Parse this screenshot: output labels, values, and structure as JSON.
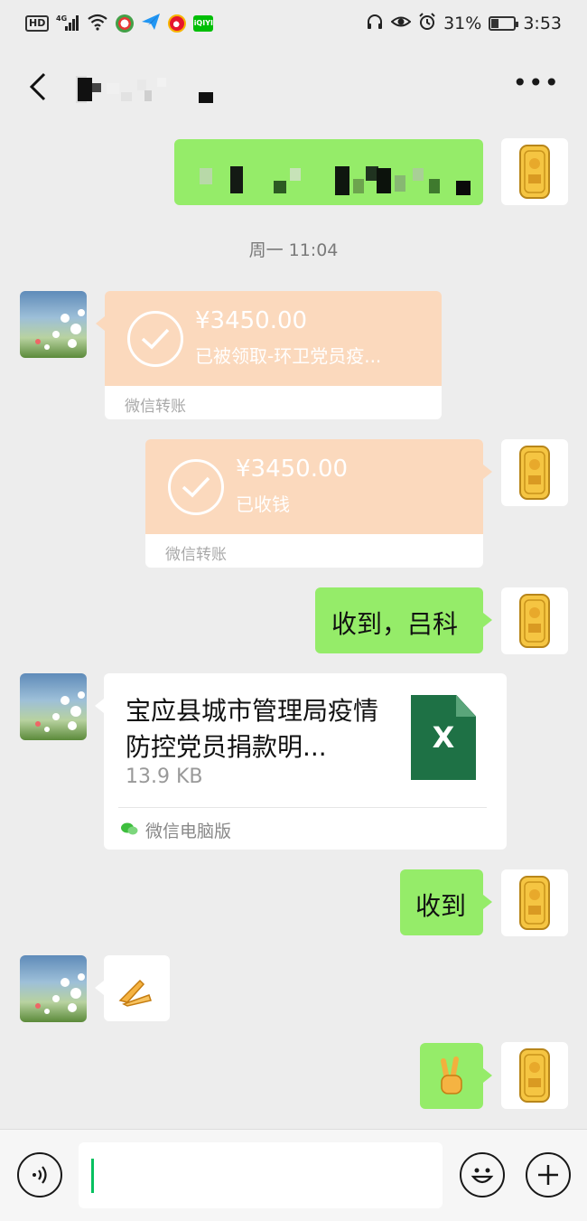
{
  "status_bar": {
    "hd": "HD",
    "network": "4G",
    "battery_percent_text": "31%",
    "battery_level": 0.31,
    "time": "3:53",
    "icons": [
      "hd-icon",
      "signal-icon",
      "wifi-icon",
      "app-icon",
      "paper-plane-icon",
      "weibo-icon",
      "iqiyi-icon",
      "headphones-icon",
      "eye-icon",
      "alarm-icon",
      "battery-icon"
    ]
  },
  "header": {
    "title_redacted": true,
    "back_icon": "chevron-left-icon",
    "more_label": "•••"
  },
  "messages": {
    "timestamp": "周一 11:04",
    "transfer_received_by_other": {
      "amount": "¥3450.00",
      "status": "已被领取-环卫党员疫...",
      "footer": "微信转账"
    },
    "transfer_received_by_me": {
      "amount": "¥3450.00",
      "status": "已收钱",
      "footer": "微信转账"
    },
    "text_1": "收到，吕科",
    "file": {
      "name": "宝应县城市管理局疫情防控党员捐款明...",
      "size": "13.9 KB",
      "icon_letter": "X",
      "source": "微信电脑版"
    },
    "text_2": "收到",
    "emoji_other": "🙏",
    "emoji_self": "✌"
  },
  "colors": {
    "background": "#ededed",
    "bubble_green": "#95ec69",
    "transfer_peach": "#fbd9bd",
    "excel_green": "#1e7145",
    "caret_green": "#07c160"
  }
}
